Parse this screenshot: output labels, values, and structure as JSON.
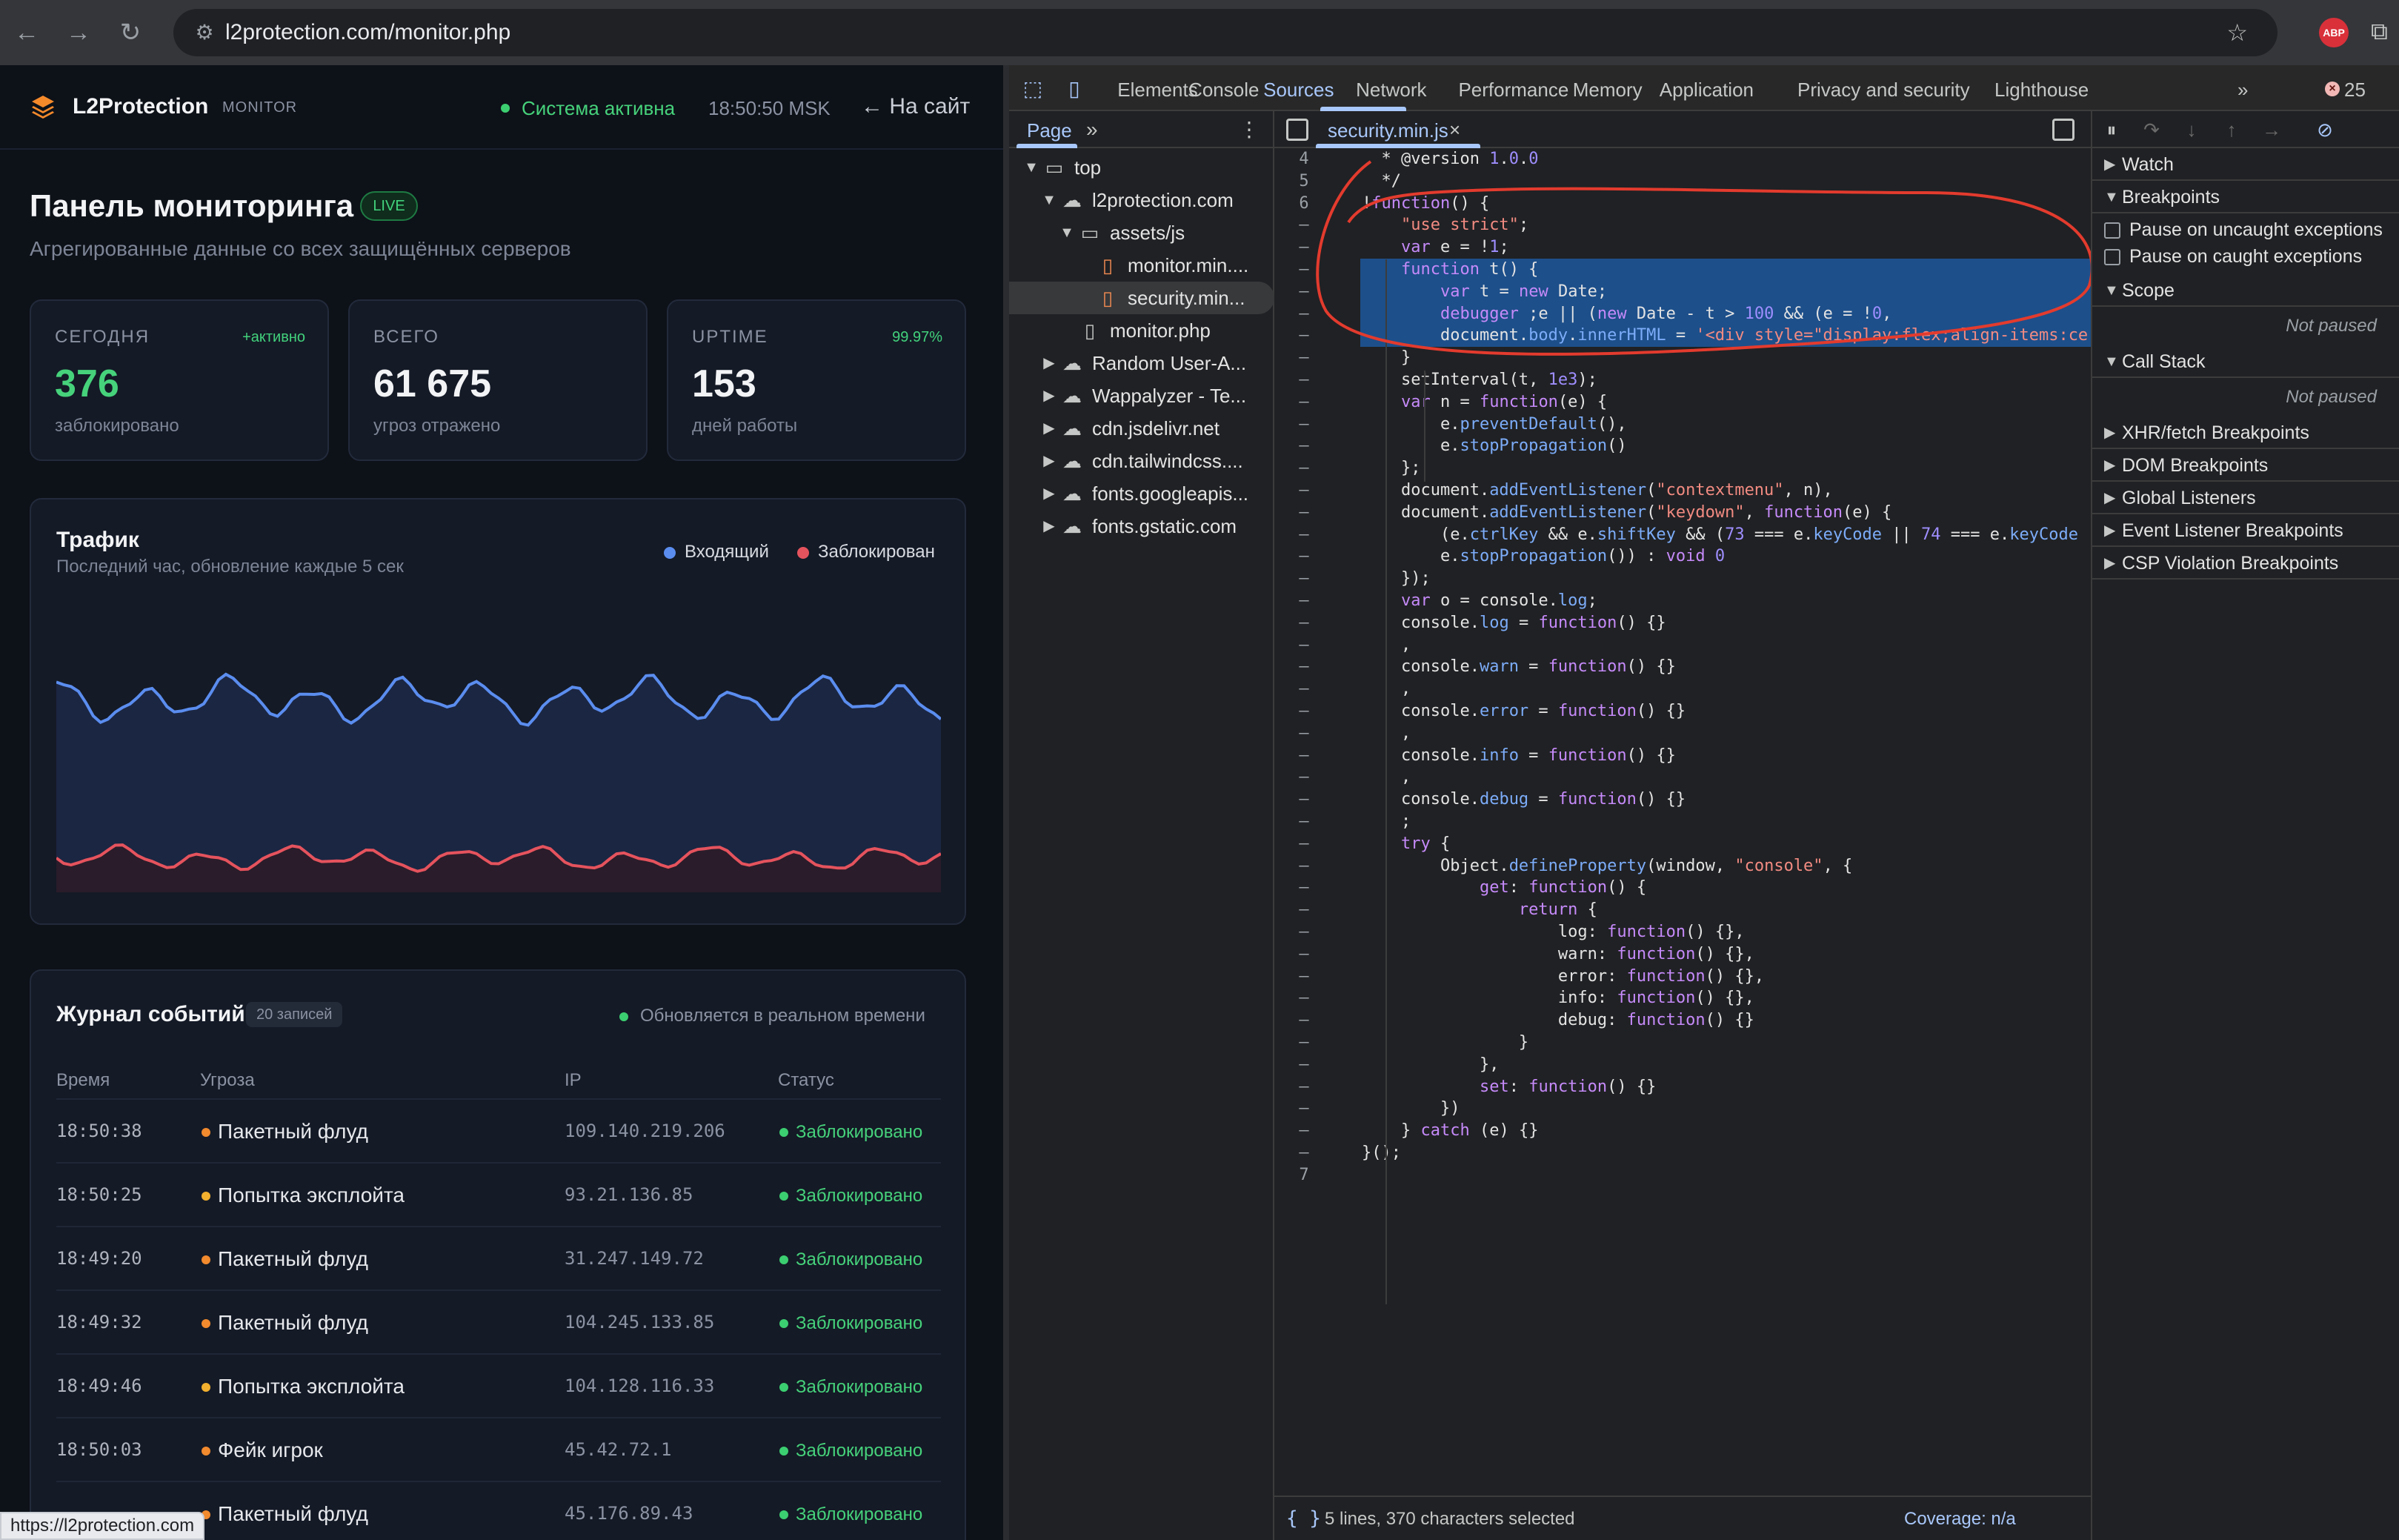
{
  "browser": {
    "url": "l2protection.com/monitor.php",
    "status_link": "https://l2protection.com"
  },
  "site": {
    "brand": "L2Protection",
    "brand_sub": "MONITOR",
    "system_status": "Система активна",
    "clock": "18:50:50 MSK",
    "back_link": "← На сайт",
    "title": "Панель мониторинга",
    "live_badge": "LIVE",
    "subtitle": "Агрегированные данные со всех защищённых серверов",
    "stats": [
      {
        "label": "СЕГОДНЯ",
        "tag": "+активно",
        "value": "376",
        "desc": "заблокировано"
      },
      {
        "label": "ВСЕГО",
        "tag": "",
        "value": "61 675",
        "desc": "угроз отражено"
      },
      {
        "label": "UPTIME",
        "tag": "99.97%",
        "value": "153",
        "desc": "дней работы"
      }
    ],
    "traffic": {
      "title": "Трафик",
      "subtitle": "Последний час, обновление каждые 5 сек",
      "legend_incoming": "Входящий",
      "legend_blocked": "Заблокирован"
    },
    "log": {
      "title": "Журнал событий",
      "count": "20 записей",
      "realtime": "Обновляется в реальном времени",
      "headers": {
        "time": "Время",
        "threat": "Угроза",
        "ip": "IP",
        "status": "Статус"
      },
      "rows": [
        {
          "time": "18:50:38",
          "threat": "Пакетный флуд",
          "ip": "109.140.219.206",
          "status": "Заблокировано"
        },
        {
          "time": "18:50:25",
          "threat": "Попытка эксплойта",
          "ip": "93.21.136.85",
          "status": "Заблокировано"
        },
        {
          "time": "18:49:20",
          "threat": "Пакетный флуд",
          "ip": "31.247.149.72",
          "status": "Заблокировано"
        },
        {
          "time": "18:49:32",
          "threat": "Пакетный флуд",
          "ip": "104.245.133.85",
          "status": "Заблокировано"
        },
        {
          "time": "18:49:46",
          "threat": "Попытка эксплойта",
          "ip": "104.128.116.33",
          "status": "Заблокировано"
        },
        {
          "time": "18:50:03",
          "threat": "Фейк игрок",
          "ip": "45.42.72.1",
          "status": "Заблокировано"
        },
        {
          "time": "",
          "threat": "Пакетный флуд",
          "ip": "45.176.89.43",
          "status": "Заблокировано"
        }
      ]
    }
  },
  "devtools": {
    "tabs": [
      "Elements",
      "Console",
      "Sources",
      "Network",
      "Performance",
      "Memory",
      "Application",
      "Privacy and security",
      "Lighthouse"
    ],
    "active_tab": "Sources",
    "error_count": "25",
    "navigator": {
      "tab": "Page",
      "tree": [
        {
          "label": "top",
          "icon": "folder",
          "twisty": "open",
          "depth": 0
        },
        {
          "label": "l2protection.com",
          "icon": "cloud",
          "twisty": "open",
          "depth": 1
        },
        {
          "label": "assets/js",
          "icon": "folder",
          "twisty": "open",
          "depth": 2
        },
        {
          "label": "monitor.min....",
          "icon": "file-js",
          "twisty": "",
          "depth": 3
        },
        {
          "label": "security.min...",
          "icon": "file-js",
          "twisty": "",
          "depth": 3
        },
        {
          "label": "monitor.php",
          "icon": "file",
          "twisty": "",
          "depth": 2
        },
        {
          "label": "Random User-A...",
          "icon": "cloud",
          "twisty": "closed",
          "depth": 1
        },
        {
          "label": "Wappalyzer - Te...",
          "icon": "cloud",
          "twisty": "closed",
          "depth": 1
        },
        {
          "label": "cdn.jsdelivr.net",
          "icon": "cloud",
          "twisty": "closed",
          "depth": 1
        },
        {
          "label": "cdn.tailwindcss....",
          "icon": "cloud",
          "twisty": "closed",
          "depth": 1
        },
        {
          "label": "fonts.googleapis...",
          "icon": "cloud",
          "twisty": "closed",
          "depth": 1
        },
        {
          "label": "fonts.gstatic.com",
          "icon": "cloud",
          "twisty": "closed",
          "depth": 1
        }
      ],
      "selected_index": 4
    },
    "editor": {
      "file_tab": "security.min.js",
      "footer_selection": "5 lines, 370 characters selected",
      "footer_coverage": "Coverage: n/a",
      "braces": "{ }"
    },
    "debugger": {
      "watch": "Watch",
      "breakpoints": "Breakpoints",
      "pause_uncaught": "Pause on uncaught exceptions",
      "pause_caught": "Pause on caught exceptions",
      "scope": "Scope",
      "not_paused_1": "Not paused",
      "call_stack": "Call Stack",
      "not_paused_2": "Not paused",
      "xhr": "XHR/fetch Breakpoints",
      "dom": "DOM Breakpoints",
      "global": "Global Listeners",
      "event": "Event Listener Breakpoints",
      "csp": "CSP Violation Breakpoints"
    }
  },
  "code_lines": [
    {
      "n": "4",
      "t": "  * @version 1.0.0"
    },
    {
      "n": "5",
      "t": "  */"
    },
    {
      "n": "6",
      "t": "!function() {"
    },
    {
      "n": "–",
      "t": "    \"use strict\";"
    },
    {
      "n": "–",
      "t": "    var e = !1;"
    },
    {
      "n": "–",
      "t": "    function t() {"
    },
    {
      "n": "–",
      "t": "        var t = new Date;"
    },
    {
      "n": "–",
      "t": "        debugger ;e || (new Date - t > 100 && (e = !0,"
    },
    {
      "n": "–",
      "t": "        document.body.innerHTML = '<div style=\"display:flex;align-items:ce"
    },
    {
      "n": "–",
      "t": "    }"
    },
    {
      "n": "–",
      "t": "    setInterval(t, 1e3);"
    },
    {
      "n": "–",
      "t": "    var n = function(e) {"
    },
    {
      "n": "–",
      "t": "        e.preventDefault(),"
    },
    {
      "n": "–",
      "t": "        e.stopPropagation()"
    },
    {
      "n": "–",
      "t": "    };"
    },
    {
      "n": "–",
      "t": "    document.addEventListener(\"contextmenu\", n),"
    },
    {
      "n": "–",
      "t": "    document.addEventListener(\"keydown\", function(e) {"
    },
    {
      "n": "–",
      "t": "        (e.ctrlKey && e.shiftKey && (73 === e.keyCode || 74 === e.keyCode"
    },
    {
      "n": "–",
      "t": "        e.stopPropagation()) : void 0"
    },
    {
      "n": "–",
      "t": "    });"
    },
    {
      "n": "–",
      "t": "    var o = console.log;"
    },
    {
      "n": "–",
      "t": "    console.log = function() {}"
    },
    {
      "n": "–",
      "t": "    ,"
    },
    {
      "n": "–",
      "t": "    console.warn = function() {}"
    },
    {
      "n": "–",
      "t": "    ,"
    },
    {
      "n": "–",
      "t": "    console.error = function() {}"
    },
    {
      "n": "–",
      "t": "    ,"
    },
    {
      "n": "–",
      "t": "    console.info = function() {}"
    },
    {
      "n": "–",
      "t": "    ,"
    },
    {
      "n": "–",
      "t": "    console.debug = function() {}"
    },
    {
      "n": "–",
      "t": "    ;"
    },
    {
      "n": "–",
      "t": "    try {"
    },
    {
      "n": "–",
      "t": "        Object.defineProperty(window, \"console\", {"
    },
    {
      "n": "–",
      "t": "            get: function() {"
    },
    {
      "n": "–",
      "t": "                return {"
    },
    {
      "n": "–",
      "t": "                    log: function() {},"
    },
    {
      "n": "–",
      "t": "                    warn: function() {},"
    },
    {
      "n": "–",
      "t": "                    error: function() {},"
    },
    {
      "n": "–",
      "t": "                    info: function() {},"
    },
    {
      "n": "–",
      "t": "                    debug: function() {}"
    },
    {
      "n": "–",
      "t": "                }"
    },
    {
      "n": "–",
      "t": "            },"
    },
    {
      "n": "–",
      "t": "            set: function() {}"
    },
    {
      "n": "–",
      "t": "        })"
    },
    {
      "n": "–",
      "t": "    } catch (e) {}"
    },
    {
      "n": "–",
      "t": "}();"
    },
    {
      "n": "7",
      "t": ""
    }
  ],
  "selected_lines": [
    5,
    6,
    7,
    8
  ],
  "colors": {
    "page_bg": "#0d1118",
    "accent_green": "#46d27b",
    "incoming_series": "#5b8def",
    "blocked_series": "#e5535d",
    "devtools_accent": "#a8c7fa",
    "annotation": "#e33b2e"
  }
}
